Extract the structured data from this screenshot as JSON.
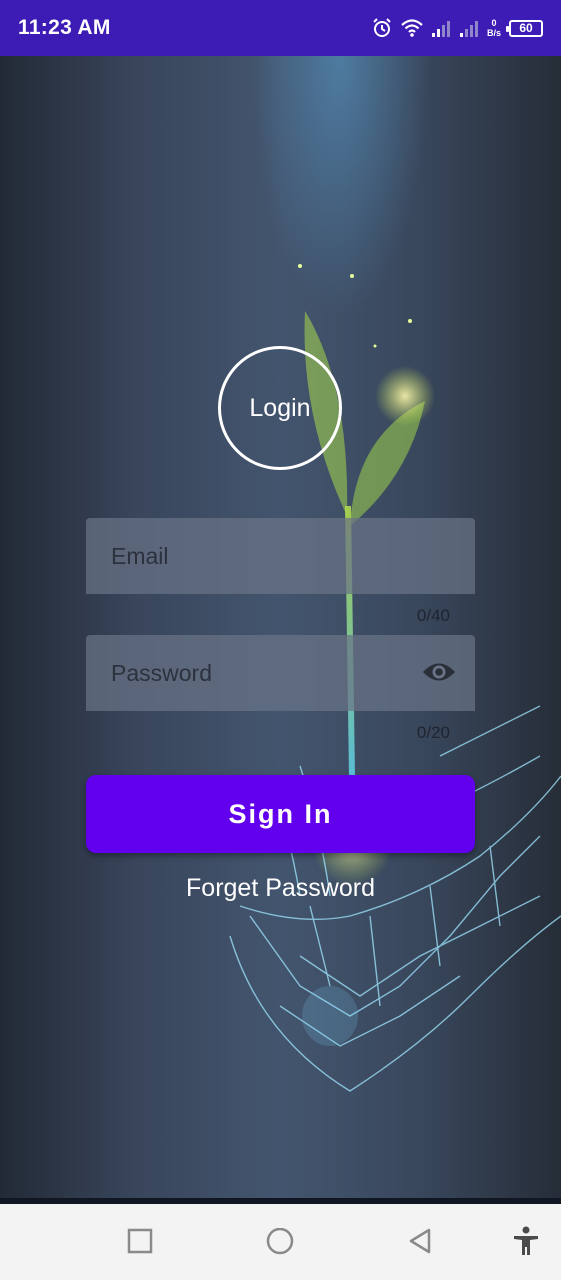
{
  "status_bar": {
    "time": "11:23 AM",
    "net_speed_value": "0",
    "net_speed_unit": "B/s",
    "battery_level": "60",
    "icons": [
      "alarm-icon",
      "wifi-icon",
      "signal-icon",
      "signal-icon",
      "battery-icon"
    ]
  },
  "login": {
    "title": "Login",
    "email": {
      "placeholder": "Email",
      "value": "",
      "counter": "0/40"
    },
    "password": {
      "placeholder": "Password",
      "value": "",
      "counter": "0/20"
    },
    "sign_in_label": "Sign In",
    "forget_password_label": "Forget Password"
  },
  "nav_bar": {
    "icons": [
      "square-recents-icon",
      "circle-home-icon",
      "triangle-back-icon",
      "accessibility-icon"
    ]
  },
  "colors": {
    "status_bar": "#3d1bb5",
    "accent": "#6200ee",
    "background": "#3a475c"
  }
}
